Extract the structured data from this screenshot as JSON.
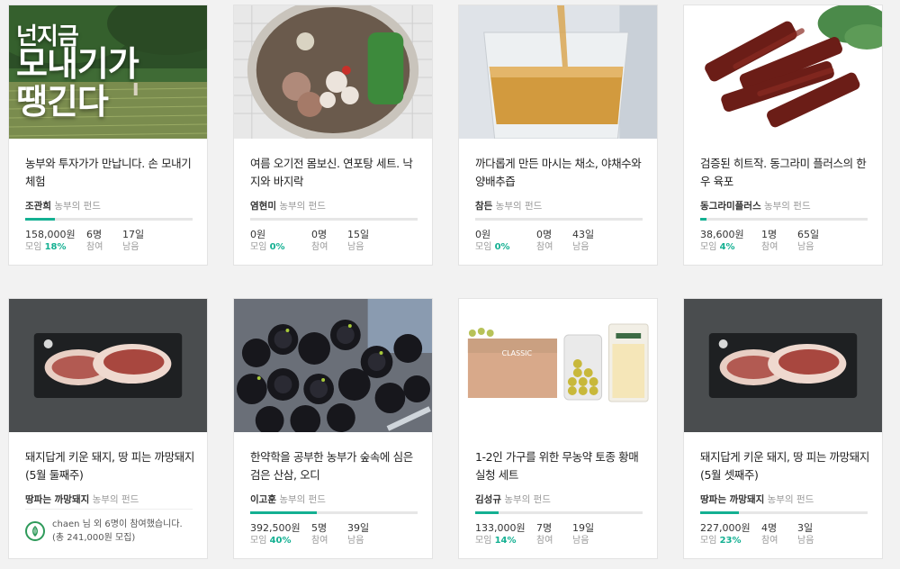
{
  "accent_color": "#14b092",
  "fund_suffix": "농부의 펀드",
  "cards": [
    {
      "image_icon": "rice-field-photo",
      "image_text_line1": "넌지금",
      "image_text_line2": "모내기가",
      "image_text_line3": "땡긴다",
      "title": "농부와 투자가가 만납니다. 손 모내기 체험",
      "farmer": "조관희",
      "progress_pct": 18,
      "amount": "158,000원",
      "amount_label": "모임",
      "percent": "18%",
      "participants": "6명",
      "participants_label": "참여",
      "days": "17일",
      "days_label": "남음"
    },
    {
      "image_icon": "octopus-soup-photo",
      "title": "여름 오기전 몸보신. 연포탕 세트. 낙지와 바지락",
      "farmer": "염현미",
      "progress_pct": 0,
      "amount": "0원",
      "amount_label": "모임",
      "percent": "0%",
      "participants": "0명",
      "participants_label": "참여",
      "days": "15일",
      "days_label": "남음"
    },
    {
      "image_icon": "tea-glass-photo",
      "title": "까다롭게 만든 마시는 채소, 야채수와 양배추즙",
      "farmer": "참든",
      "progress_pct": 0,
      "amount": "0원",
      "amount_label": "모임",
      "percent": "0%",
      "participants": "0명",
      "participants_label": "참여",
      "days": "43일",
      "days_label": "남음"
    },
    {
      "image_icon": "beef-jerky-photo",
      "title": "검증된 히트작. 동그라미 플러스의 한우 육포",
      "farmer": "동그라미플러스",
      "progress_pct": 4,
      "amount": "38,600원",
      "amount_label": "모임",
      "percent": "4%",
      "participants": "1명",
      "participants_label": "참여",
      "days": "65일",
      "days_label": "남음"
    },
    {
      "image_icon": "pork-belly-photo",
      "title": "돼지답게 키운 돼지, 땅 피는 까망돼지 (5월 둘째주)",
      "farmer": "땅파는 까망돼지",
      "supporter_icon": "leaf-logo-icon",
      "supporter_text": "chaen 님 외 6명이 참여했습니다. (총 241,000원 모집)"
    },
    {
      "image_icon": "mulberry-photo",
      "title": "한약학을 공부한 농부가 숲속에 심은 검은 산삼, 오디",
      "farmer": "이고훈",
      "progress_pct": 40,
      "amount": "392,500원",
      "amount_label": "모임",
      "percent": "40%",
      "participants": "5명",
      "participants_label": "참여",
      "days": "39일",
      "days_label": "남음"
    },
    {
      "image_icon": "plum-products-photo",
      "image_box_label": "CLASSIC",
      "title": "1-2인 가구를 위한 무농약 토종 황매 실청 세트",
      "farmer": "김성규",
      "progress_pct": 14,
      "amount": "133,000원",
      "amount_label": "모임",
      "percent": "14%",
      "participants": "7명",
      "participants_label": "참여",
      "days": "19일",
      "days_label": "남음"
    },
    {
      "image_icon": "pork-belly-photo",
      "title": "돼지답게 키운 돼지, 땅 피는 까망돼지 (5월 셋째주)",
      "farmer": "땅파는 까망돼지",
      "progress_pct": 23,
      "amount": "227,000원",
      "amount_label": "모임",
      "percent": "23%",
      "participants": "4명",
      "participants_label": "참여",
      "days": "3일",
      "days_label": "남음"
    }
  ]
}
